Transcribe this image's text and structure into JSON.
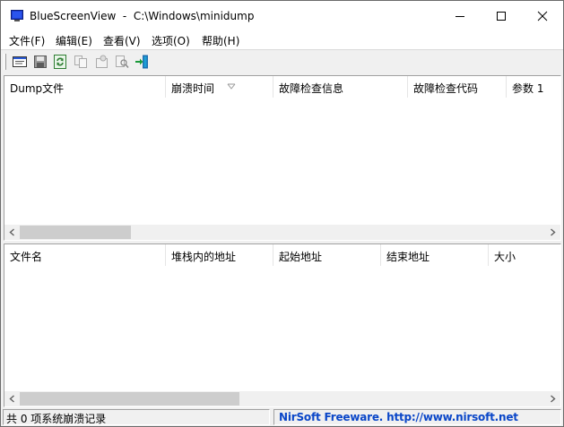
{
  "window": {
    "title": "BlueScreenView  -  C:\\Windows\\minidump",
    "app_icon": "bluescreenview-app-icon",
    "controls": [
      "minimize-icon",
      "maximize-icon",
      "close-icon"
    ]
  },
  "menu": {
    "items": [
      "文件(F)",
      "编辑(E)",
      "查看(V)",
      "选项(O)",
      "帮助(H)"
    ]
  },
  "toolbar": {
    "buttons": [
      "properties-window-icon",
      "save-icon",
      "refresh-icon",
      "copy-icon",
      "advanced-options-icon",
      "find-icon",
      "exit-icon"
    ]
  },
  "upper_list": {
    "columns": [
      "Dump文件",
      "崩溃时间",
      "故障检查信息",
      "故障检查代码",
      "参数 1"
    ],
    "sorted_column": "崩溃时间",
    "rows": []
  },
  "lower_list": {
    "columns": [
      "文件名",
      "堆栈内的地址",
      "起始地址",
      "结束地址",
      "大小"
    ],
    "rows": []
  },
  "status": {
    "left": "共 0 项系统崩溃记录",
    "right": "NirSoft Freeware.  http://www.nirsoft.net",
    "link_color": "#0a46c8"
  },
  "colors": {
    "window_bg": "#f0f0f0",
    "list_bg": "#ffffff",
    "scroll_thumb": "#cdcdcd"
  }
}
